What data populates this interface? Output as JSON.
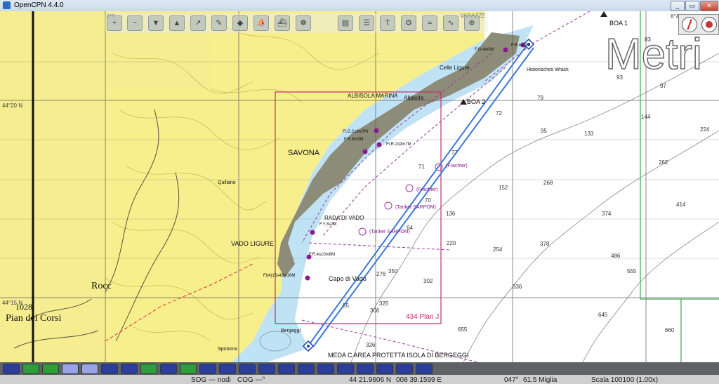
{
  "window": {
    "title": "OpenCPN 4.4.0",
    "min_label": "_",
    "max_label": "▭",
    "close_label": "✕"
  },
  "toolbar": {
    "tools": [
      {
        "name": "zoom-in-icon",
        "glyph": "+"
      },
      {
        "name": "zoom-out-icon",
        "glyph": "−"
      },
      {
        "name": "scale-in-icon",
        "glyph": "▼"
      },
      {
        "name": "scale-out-icon",
        "glyph": "▲"
      },
      {
        "name": "route-icon",
        "glyph": "↗"
      },
      {
        "name": "measure-icon",
        "glyph": "✎"
      },
      {
        "name": "ais-icon",
        "glyph": "◆"
      },
      {
        "name": "tracks-icon",
        "glyph": "⛵"
      },
      {
        "name": "boat-icon",
        "glyph": "⛴"
      },
      {
        "name": "auto-follow-icon",
        "glyph": "☸"
      },
      {
        "name": "print-icon",
        "glyph": "▤"
      },
      {
        "name": "route-manager-icon",
        "glyph": "☰"
      },
      {
        "name": "text-icon",
        "glyph": "T"
      },
      {
        "name": "settings-icon",
        "glyph": "⚙"
      },
      {
        "name": "current-icon",
        "glyph": "≈"
      },
      {
        "name": "tide-icon",
        "glyph": "∿"
      },
      {
        "name": "mob-icon",
        "glyph": "⊕"
      },
      {
        "name": "help-icon",
        "glyph": "?"
      }
    ]
  },
  "chart": {
    "watermark": "Metri",
    "plan_label": "434 Plan J",
    "lat_labels": [
      "44°20 N",
      "44°15 N"
    ],
    "lon_labels": [
      "8°5",
      "8°4"
    ],
    "place_labels": {
      "savona": "SAVONA",
      "vado_ligure": "VADO LIGURE",
      "albisola_marina": "ALBISOLA MARINA",
      "albisola": "Albisola",
      "varazze": "VARAZZE",
      "celle_ligure": "Celle Ligure",
      "capo_di_vado": "Capo di Vado",
      "rada_di_vado": "RADA DI VADO",
      "bergeggi": "Bergeggi",
      "spotorno": "Spotorno",
      "quiliano": "Quiliano",
      "rocca": "Rocc",
      "pian_dei_corsi": "Pian dei Corsi",
      "pian_height": "1028",
      "historisches_wrack": "Historisches Wrack"
    },
    "buoys": {
      "boa1": "BOA 1",
      "boa2": "BOA 2"
    },
    "meda_note": "MEDA C AREA PROTETTA ISOLA DI BERGEGGI",
    "light_labels": [
      "F.G.4m8M",
      "F.R.4m3M",
      "Fl.G.2s9m7M",
      "F.R.8m5M",
      "Fl.R.2s9m7M",
      "F.Y.3s2M",
      "F.R.4s10m8M",
      "Fl(4)15s43m16M"
    ],
    "anchorage_labels": [
      "(Frachter)",
      "(Frachter)",
      "(Tanker SARPOM)",
      "(Tanker SARPOM)"
    ],
    "depths": [
      "83",
      "97",
      "93",
      "79",
      "72",
      "95",
      "133",
      "144",
      "224",
      "136",
      "152",
      "268",
      "262",
      "414",
      "374",
      "220",
      "254",
      "378",
      "486",
      "555",
      "336",
      "302",
      "350",
      "276",
      "325",
      "306",
      "645",
      "655",
      "660",
      "326",
      "55",
      "64",
      "70",
      "71",
      "77"
    ]
  },
  "piano": {
    "keys": [
      "#2c3e9c",
      "#2e9e3a",
      "#2e9e3a",
      "#9aa3e8",
      "#9aa3e8",
      "#2c3e9c",
      "#2c3e9c",
      "#2e9e3a",
      "#2c3e9c",
      "#2e9e3a",
      "#2c3e9c",
      "#2c3e9c",
      "#2c3e9c",
      "#2c3e9c",
      "#2c3e9c",
      "#2c3e9c",
      "#2c3e9c",
      "#2c3e9c",
      "#2c3e9c",
      "#2c3e9c",
      "#2c3e9c",
      "#2c3e9c"
    ]
  },
  "status": {
    "sog": "SOG --- nodi",
    "cog": "COG ---°",
    "lat": "44 21.9606 N",
    "lon": "008 39.1599 E",
    "bearing": "047°",
    "distance": "61.5 Miglia",
    "scale": "Scala 100100 (1.00x)"
  },
  "colors": {
    "land": "#f5ed90",
    "dense_land": "#f7ee8c",
    "shallow_water": "#bfe3f5",
    "deep_water": "#ffffff",
    "urban": "#8c8c78",
    "contour_purple": "#a0379c",
    "route_blue": "#3b78d6",
    "plan_border": "#c0306b"
  }
}
